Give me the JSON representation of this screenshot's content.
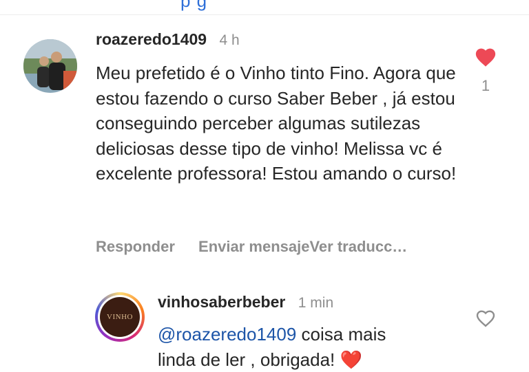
{
  "top_fragment": "p g",
  "comments": [
    {
      "username": "roazeredo1409",
      "time": "4 h",
      "text": "Meu prefetido é o Vinho tinto Fino. Agora que estou fazendo o curso Saber Beber , já estou conseguindo perceber algumas sutilezas deliciosas desse tipo de vinho! Melissa vc é excelente professora! Estou amando o curso!",
      "reply_label": "Responder",
      "send_label": "Enviar mensajeVer traducc…",
      "like_count": "1",
      "liked": true
    }
  ],
  "reply": {
    "username": "vinhosaberbeber",
    "time": "1 min",
    "avatar_text": "VINHO",
    "mention": "@roazeredo1409",
    "text_part1": " coisa mais",
    "text_part2": "linda de ler , obrigada! ",
    "emoji": "❤️",
    "liked": false
  },
  "colors": {
    "like_active": "#ed4956",
    "mention": "#1d55a8",
    "meta": "#8e8e8e"
  }
}
